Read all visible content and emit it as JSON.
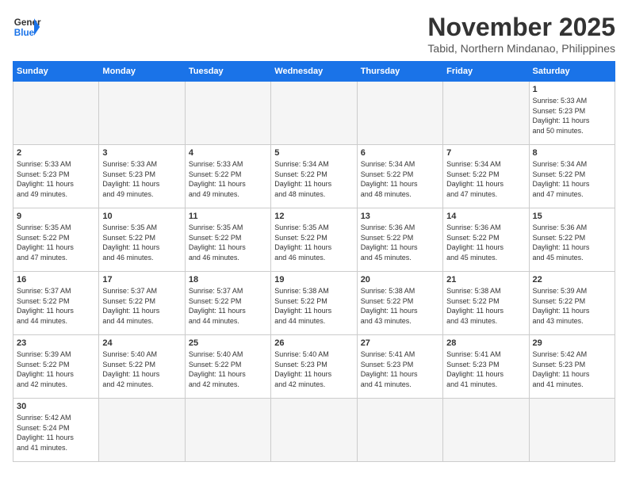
{
  "header": {
    "logo_general": "General",
    "logo_blue": "Blue",
    "month_title": "November 2025",
    "subtitle": "Tabid, Northern Mindanao, Philippines"
  },
  "weekdays": [
    "Sunday",
    "Monday",
    "Tuesday",
    "Wednesday",
    "Thursday",
    "Friday",
    "Saturday"
  ],
  "weeks": [
    [
      {
        "day": "",
        "info": ""
      },
      {
        "day": "",
        "info": ""
      },
      {
        "day": "",
        "info": ""
      },
      {
        "day": "",
        "info": ""
      },
      {
        "day": "",
        "info": ""
      },
      {
        "day": "",
        "info": ""
      },
      {
        "day": "1",
        "info": "Sunrise: 5:33 AM\nSunset: 5:23 PM\nDaylight: 11 hours\nand 50 minutes."
      }
    ],
    [
      {
        "day": "2",
        "info": "Sunrise: 5:33 AM\nSunset: 5:23 PM\nDaylight: 11 hours\nand 49 minutes."
      },
      {
        "day": "3",
        "info": "Sunrise: 5:33 AM\nSunset: 5:23 PM\nDaylight: 11 hours\nand 49 minutes."
      },
      {
        "day": "4",
        "info": "Sunrise: 5:33 AM\nSunset: 5:22 PM\nDaylight: 11 hours\nand 49 minutes."
      },
      {
        "day": "5",
        "info": "Sunrise: 5:34 AM\nSunset: 5:22 PM\nDaylight: 11 hours\nand 48 minutes."
      },
      {
        "day": "6",
        "info": "Sunrise: 5:34 AM\nSunset: 5:22 PM\nDaylight: 11 hours\nand 48 minutes."
      },
      {
        "day": "7",
        "info": "Sunrise: 5:34 AM\nSunset: 5:22 PM\nDaylight: 11 hours\nand 47 minutes."
      },
      {
        "day": "8",
        "info": "Sunrise: 5:34 AM\nSunset: 5:22 PM\nDaylight: 11 hours\nand 47 minutes."
      }
    ],
    [
      {
        "day": "9",
        "info": "Sunrise: 5:35 AM\nSunset: 5:22 PM\nDaylight: 11 hours\nand 47 minutes."
      },
      {
        "day": "10",
        "info": "Sunrise: 5:35 AM\nSunset: 5:22 PM\nDaylight: 11 hours\nand 46 minutes."
      },
      {
        "day": "11",
        "info": "Sunrise: 5:35 AM\nSunset: 5:22 PM\nDaylight: 11 hours\nand 46 minutes."
      },
      {
        "day": "12",
        "info": "Sunrise: 5:35 AM\nSunset: 5:22 PM\nDaylight: 11 hours\nand 46 minutes."
      },
      {
        "day": "13",
        "info": "Sunrise: 5:36 AM\nSunset: 5:22 PM\nDaylight: 11 hours\nand 45 minutes."
      },
      {
        "day": "14",
        "info": "Sunrise: 5:36 AM\nSunset: 5:22 PM\nDaylight: 11 hours\nand 45 minutes."
      },
      {
        "day": "15",
        "info": "Sunrise: 5:36 AM\nSunset: 5:22 PM\nDaylight: 11 hours\nand 45 minutes."
      }
    ],
    [
      {
        "day": "16",
        "info": "Sunrise: 5:37 AM\nSunset: 5:22 PM\nDaylight: 11 hours\nand 44 minutes."
      },
      {
        "day": "17",
        "info": "Sunrise: 5:37 AM\nSunset: 5:22 PM\nDaylight: 11 hours\nand 44 minutes."
      },
      {
        "day": "18",
        "info": "Sunrise: 5:37 AM\nSunset: 5:22 PM\nDaylight: 11 hours\nand 44 minutes."
      },
      {
        "day": "19",
        "info": "Sunrise: 5:38 AM\nSunset: 5:22 PM\nDaylight: 11 hours\nand 44 minutes."
      },
      {
        "day": "20",
        "info": "Sunrise: 5:38 AM\nSunset: 5:22 PM\nDaylight: 11 hours\nand 43 minutes."
      },
      {
        "day": "21",
        "info": "Sunrise: 5:38 AM\nSunset: 5:22 PM\nDaylight: 11 hours\nand 43 minutes."
      },
      {
        "day": "22",
        "info": "Sunrise: 5:39 AM\nSunset: 5:22 PM\nDaylight: 11 hours\nand 43 minutes."
      }
    ],
    [
      {
        "day": "23",
        "info": "Sunrise: 5:39 AM\nSunset: 5:22 PM\nDaylight: 11 hours\nand 42 minutes."
      },
      {
        "day": "24",
        "info": "Sunrise: 5:40 AM\nSunset: 5:22 PM\nDaylight: 11 hours\nand 42 minutes."
      },
      {
        "day": "25",
        "info": "Sunrise: 5:40 AM\nSunset: 5:22 PM\nDaylight: 11 hours\nand 42 minutes."
      },
      {
        "day": "26",
        "info": "Sunrise: 5:40 AM\nSunset: 5:23 PM\nDaylight: 11 hours\nand 42 minutes."
      },
      {
        "day": "27",
        "info": "Sunrise: 5:41 AM\nSunset: 5:23 PM\nDaylight: 11 hours\nand 41 minutes."
      },
      {
        "day": "28",
        "info": "Sunrise: 5:41 AM\nSunset: 5:23 PM\nDaylight: 11 hours\nand 41 minutes."
      },
      {
        "day": "29",
        "info": "Sunrise: 5:42 AM\nSunset: 5:23 PM\nDaylight: 11 hours\nand 41 minutes."
      }
    ],
    [
      {
        "day": "30",
        "info": "Sunrise: 5:42 AM\nSunset: 5:24 PM\nDaylight: 11 hours\nand 41 minutes."
      },
      {
        "day": "",
        "info": ""
      },
      {
        "day": "",
        "info": ""
      },
      {
        "day": "",
        "info": ""
      },
      {
        "day": "",
        "info": ""
      },
      {
        "day": "",
        "info": ""
      },
      {
        "day": "",
        "info": ""
      }
    ]
  ]
}
